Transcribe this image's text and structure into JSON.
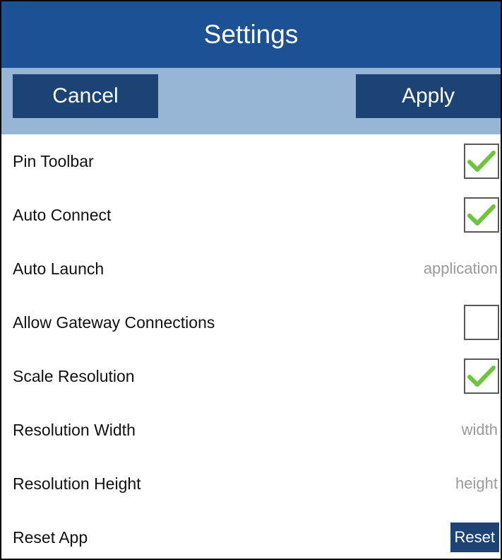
{
  "header": {
    "title": "Settings"
  },
  "actions": {
    "cancel_label": "Cancel",
    "apply_label": "Apply"
  },
  "settings": {
    "pin_toolbar": {
      "label": "Pin Toolbar",
      "checked": true
    },
    "auto_connect": {
      "label": "Auto Connect",
      "checked": true
    },
    "auto_launch": {
      "label": "Auto Launch",
      "placeholder": "application"
    },
    "allow_gateway": {
      "label": "Allow Gateway Connections",
      "checked": false
    },
    "scale_resolution": {
      "label": "Scale Resolution",
      "checked": true
    },
    "resolution_width": {
      "label": "Resolution Width",
      "placeholder": "width"
    },
    "resolution_height": {
      "label": "Resolution Height",
      "placeholder": "height"
    },
    "reset_app": {
      "label": "Reset App",
      "button_label": "Reset"
    }
  },
  "colors": {
    "title_bar": "#1c5193",
    "action_bar": "#97b5d5",
    "button": "#1b4373",
    "check": "#6cc63c"
  },
  "icons": {
    "check": "checkmark-icon"
  }
}
